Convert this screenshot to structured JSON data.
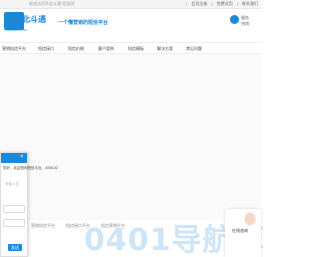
{
  "topbar": {
    "welcome": "欢迎访问华北斗通·短信网",
    "links": [
      "|",
      "会员注册",
      "|",
      "免费试用",
      "|",
      "联系我们"
    ]
  },
  "brand": {
    "logo_text": "北斗通",
    "logo_sub": "HUABEIDOUTONG",
    "slogan": "一个懂营销的短信平台",
    "hotline_label": "服务",
    "hotline_value": "热线：",
    "accent": "#1e88d8"
  },
  "nav": {
    "items": [
      "营销短信平台",
      "短信接口",
      "短信价格",
      "客户案例",
      "短信模板",
      "解决方案",
      "常见问题"
    ]
  },
  "footer": {
    "links": [
      "营销短信平台",
      "短信接口平台",
      "短信营销平台"
    ]
  },
  "chat": {
    "close": "×",
    "message": "您好，欢迎咨询短信平台，4008-92",
    "placeholder": "请输入您",
    "send": "发送"
  },
  "contact": {
    "name": "在线咨询"
  },
  "watermark": "0401导航库"
}
